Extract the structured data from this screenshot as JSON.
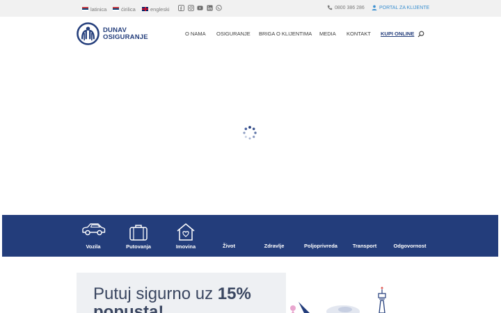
{
  "topbar": {
    "languages": [
      {
        "label": "latinica",
        "flag": "serbia-flag-icon"
      },
      {
        "label": "ćirilica",
        "flag": "serbia-flag-icon"
      },
      {
        "label": "engleski",
        "flag": "uk-flag-icon"
      }
    ],
    "social_icons": [
      "facebook-icon",
      "instagram-icon",
      "youtube-icon",
      "linkedin-icon",
      "viber-icon"
    ],
    "phone": "0800 386 286",
    "portal": "PORTAL ZA KLIJENTE"
  },
  "brand": {
    "line1": "DUNAV",
    "line2": "OSIGURANJE",
    "color": "#233d7b"
  },
  "nav": {
    "items": [
      "O NAMA",
      "OSIGURANJE",
      "BRIGA O KLIJENTIMA",
      "MEDIA",
      "KONTAKT",
      "KUPI ONLINE"
    ],
    "search_icon": "search-icon"
  },
  "categories": [
    {
      "label": "Vozila",
      "icon": "car-icon"
    },
    {
      "label": "Putovanja",
      "icon": "suitcase-icon"
    },
    {
      "label": "Imovina",
      "icon": "house-heart-icon"
    },
    {
      "label": "Život",
      "icon": ""
    },
    {
      "label": "Zdravlje",
      "icon": ""
    },
    {
      "label": "Poljoprivreda",
      "icon": ""
    },
    {
      "label": "Transport",
      "icon": ""
    },
    {
      "label": "Odgovornost",
      "icon": ""
    }
  ],
  "promo": {
    "title_start": "Putuj sigurno uz ",
    "title_bold": "15%",
    "title_line2": "popusta!"
  },
  "colors": {
    "accent": "#233d7b",
    "link": "#3a8fd0",
    "topbar_bg": "#f1f1f1"
  }
}
